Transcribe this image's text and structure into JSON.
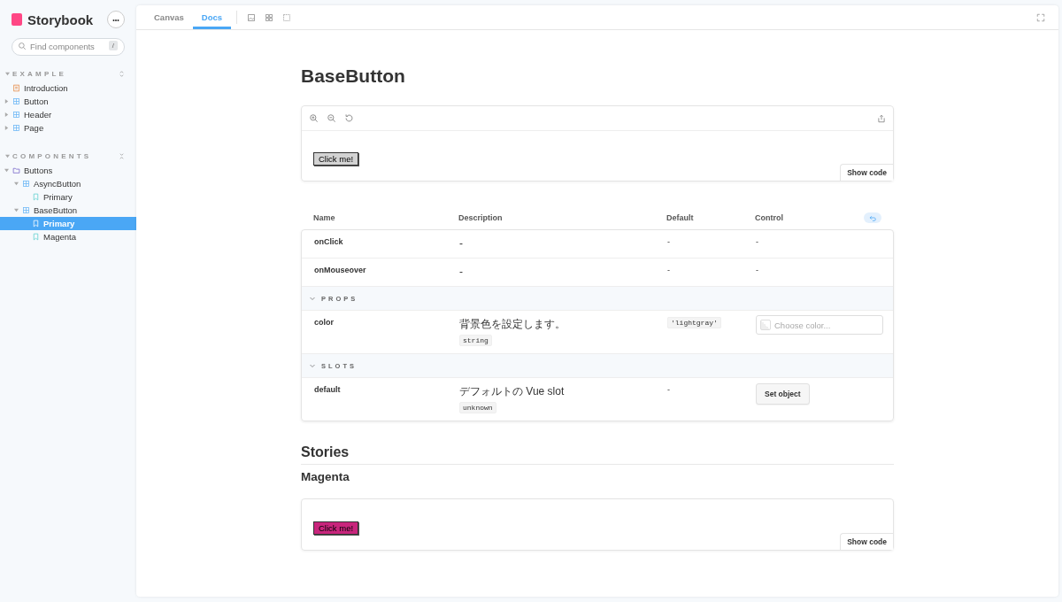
{
  "sidebar": {
    "brand": "Storybook",
    "menu_glyph": "•••",
    "search": {
      "placeholder": "Find components",
      "shortcut": "/"
    },
    "sections": [
      {
        "title": "EXAMPLE",
        "expanded": true,
        "items": [
          {
            "label": "Introduction",
            "kind": "document",
            "selected": false
          },
          {
            "label": "Button",
            "kind": "component",
            "expanded": false,
            "selected": false
          },
          {
            "label": "Header",
            "kind": "component",
            "expanded": false,
            "selected": false
          },
          {
            "label": "Page",
            "kind": "component",
            "expanded": false,
            "selected": false
          }
        ]
      },
      {
        "title": "COMPONENTS",
        "expanded": true,
        "items": [
          {
            "label": "Buttons",
            "kind": "folder",
            "expanded": true,
            "selected": false,
            "children": [
              {
                "label": "AsyncButton",
                "kind": "component",
                "expanded": true,
                "selected": false,
                "children": [
                  {
                    "label": "Primary",
                    "kind": "story",
                    "selected": false
                  }
                ]
              },
              {
                "label": "BaseButton",
                "kind": "component",
                "expanded": true,
                "selected": false,
                "children": [
                  {
                    "label": "Primary",
                    "kind": "story",
                    "selected": true
                  },
                  {
                    "label": "Magenta",
                    "kind": "story",
                    "selected": false
                  }
                ]
              }
            ]
          }
        ]
      }
    ]
  },
  "tabs": [
    {
      "label": "Canvas",
      "selected": false
    },
    {
      "label": "Docs",
      "selected": true
    }
  ],
  "docs": {
    "title": "BaseButton",
    "preview": {
      "button": "Click me!",
      "color": "#d3d3d3",
      "show_code": "Show code"
    },
    "args_table": {
      "columns": [
        "Name",
        "Description",
        "Default",
        "Control"
      ],
      "rows": [
        {
          "kind": "arg",
          "name": "onClick",
          "description": "-",
          "default": {
            "text": "-",
            "kind": "plain"
          },
          "control": {
            "kind": "none",
            "text": "-"
          }
        },
        {
          "kind": "arg",
          "name": "onMouseover",
          "description": "-",
          "default": {
            "text": "-",
            "kind": "plain"
          },
          "control": {
            "kind": "none",
            "text": "-"
          }
        },
        {
          "kind": "section",
          "title": "PROPS",
          "expanded": true
        },
        {
          "kind": "arg",
          "name": "color",
          "description": "背景色を設定します。",
          "type": "string",
          "default": {
            "text": "'lightgray'",
            "kind": "code"
          },
          "control": {
            "kind": "color",
            "placeholder": "Choose color..."
          }
        },
        {
          "kind": "section",
          "title": "SLOTS",
          "expanded": true
        },
        {
          "kind": "arg",
          "name": "default",
          "description": "デフォルトの Vue slot",
          "type": "unknown",
          "default": {
            "text": "-",
            "kind": "plain"
          },
          "control": {
            "kind": "button",
            "label": "Set object"
          }
        }
      ]
    },
    "stories_heading": "Stories",
    "stories": [
      {
        "title": "Magenta",
        "preview": {
          "button": "Click me!",
          "color": "#c8257c",
          "show_code": "Show code"
        }
      }
    ]
  }
}
